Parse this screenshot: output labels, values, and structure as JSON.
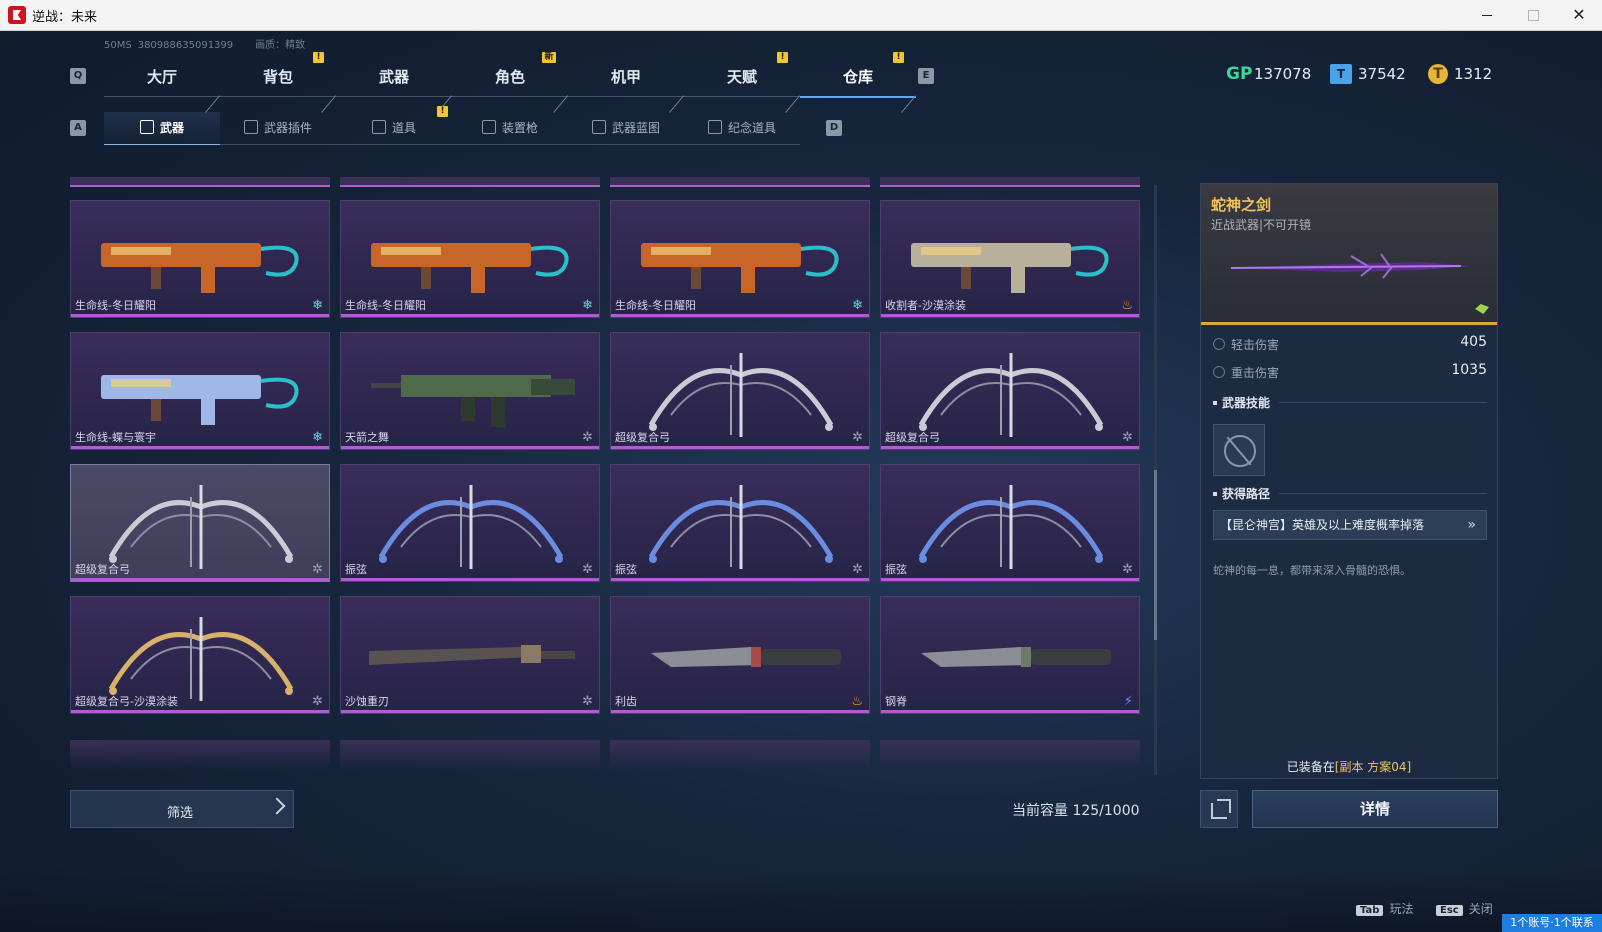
{
  "window": {
    "title": "逆战：未来"
  },
  "meta": {
    "ping": "50MS",
    "id": "380988635091399",
    "quality": "画质：精致"
  },
  "keys": {
    "prev_main": "Q",
    "next_main": "E",
    "prev_sub": "A",
    "next_sub": "D"
  },
  "main_tabs": [
    {
      "label": "大厅"
    },
    {
      "label": "背包",
      "badge": "!"
    },
    {
      "label": "武器"
    },
    {
      "label": "角色",
      "badge": "新"
    },
    {
      "label": "机甲"
    },
    {
      "label": "天赋",
      "badge": "!"
    },
    {
      "label": "仓库",
      "badge": "!",
      "active": true
    }
  ],
  "currency": {
    "gp_icon": "GP",
    "gp": "137078",
    "card_icon": "card-icon",
    "card": "37542",
    "coin_icon": "coin-icon",
    "coin": "1312"
  },
  "sub_tabs": [
    {
      "label": "武器",
      "active": true
    },
    {
      "label": "武器插件"
    },
    {
      "label": "道具",
      "badge": "!"
    },
    {
      "label": "装置枪"
    },
    {
      "label": "武器蓝图"
    },
    {
      "label": "纪念道具"
    }
  ],
  "items": [
    {
      "name": "生命线-冬日耀阳",
      "tag": "frost",
      "kind": "gun",
      "color": "#c8662a"
    },
    {
      "name": "生命线-冬日耀阳",
      "tag": "frost",
      "kind": "gun",
      "color": "#c8662a"
    },
    {
      "name": "生命线-冬日耀阳",
      "tag": "frost",
      "kind": "gun",
      "color": "#c8662a"
    },
    {
      "name": "收割者-沙漠涂装",
      "tag": "fire",
      "kind": "gun",
      "color": "#b8b09a"
    },
    {
      "name": "生命线-蝶与寰宇",
      "tag": "frost",
      "kind": "gun",
      "color": "#9fb8e8"
    },
    {
      "name": "天箭之舞",
      "tag": "none",
      "kind": "rifle",
      "color": "#4e6a4a"
    },
    {
      "name": "超级复合弓",
      "tag": "none",
      "kind": "bow",
      "color": "#c9ccd4"
    },
    {
      "name": "超级复合弓",
      "tag": "none",
      "kind": "bow",
      "color": "#c9ccd4"
    },
    {
      "name": "超级复合弓",
      "tag": "none",
      "kind": "bow",
      "color": "#c9ccd4",
      "selected": true
    },
    {
      "name": "振弦",
      "tag": "none",
      "kind": "bow",
      "color": "#6a8de0"
    },
    {
      "name": "振弦",
      "tag": "none",
      "kind": "bow",
      "color": "#6a8de0"
    },
    {
      "name": "振弦",
      "tag": "none",
      "kind": "bow",
      "color": "#6a8de0"
    },
    {
      "name": "超级复合弓-沙漠涂装",
      "tag": "none",
      "kind": "bow",
      "color": "#d7b26a"
    },
    {
      "name": "沙蚀重刃",
      "tag": "none",
      "kind": "blade",
      "color": "#8a7a64"
    },
    {
      "name": "利齿",
      "tag": "fire",
      "kind": "knife",
      "color": "#a94a4a"
    },
    {
      "name": "钢脊",
      "tag": "bolt",
      "kind": "knife",
      "color": "#6c7a6a"
    }
  ],
  "filter": {
    "label": "筛选"
  },
  "capacity": {
    "label": "当前容量 125/1000"
  },
  "detail": {
    "name": "蛇神之剑",
    "type": "近战武器|不可开镜",
    "stats": [
      {
        "label": "轻击伤害",
        "value": "405"
      },
      {
        "label": "重击伤害",
        "value": "1035"
      }
    ],
    "skill_title": "武器技能",
    "route_title": "获得路径",
    "route": "【昆仑神宫】英雄及以上难度概率掉落",
    "description": "蛇神的每一息，都带来深入骨髓的恐惧。",
    "equipped_prefix": "已装备在",
    "equipped_value": "[副本 方案04]",
    "detail_button": "详情"
  },
  "hints": [
    {
      "key": "Tab",
      "label": "玩法"
    },
    {
      "key": "Esc",
      "label": "关闭"
    }
  ],
  "toast": "1个账号·1个联系"
}
